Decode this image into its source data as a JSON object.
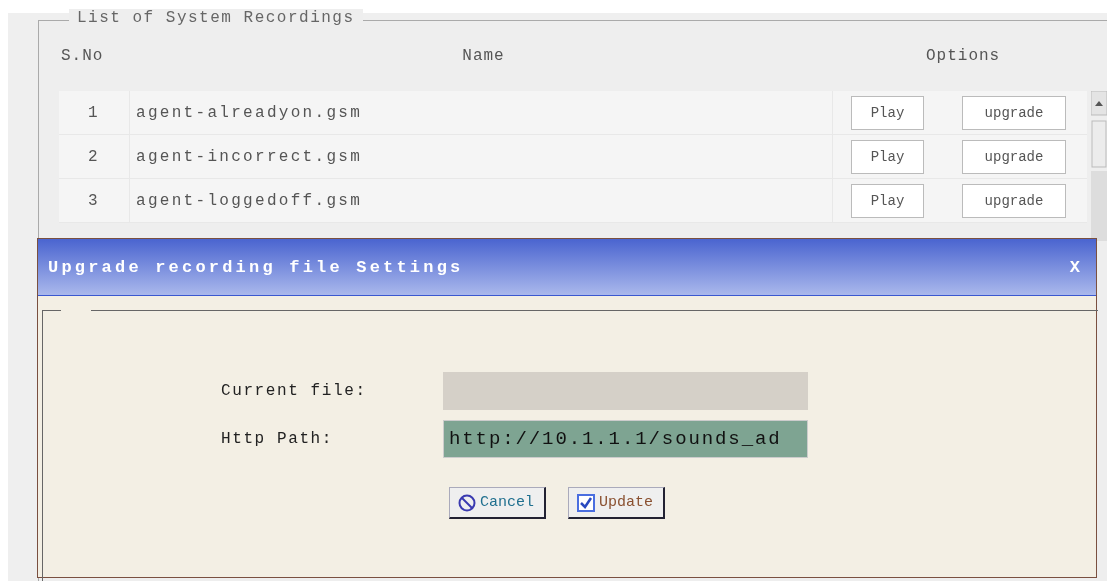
{
  "recordings": {
    "title": "List of System Recordings",
    "columns": [
      "S.No",
      "Name",
      "Options"
    ],
    "rows": [
      {
        "number": "1",
        "name": "agent-alreadyon.gsm",
        "play": "Play",
        "upgrade": "upgrade"
      },
      {
        "number": "2",
        "name": "agent-incorrect.gsm",
        "play": "Play",
        "upgrade": "upgrade"
      },
      {
        "number": "3",
        "name": "agent-loggedoff.gsm",
        "play": "Play",
        "upgrade": "upgrade"
      }
    ]
  },
  "dialog": {
    "title": "Upgrade recording file Settings",
    "close": "X",
    "fields": [
      {
        "label": "Current file:",
        "disabled": true
      },
      {
        "label": "Http Path:",
        "value": "http://10.1.1.1/sounds_ad",
        "disabled": false
      }
    ],
    "buttons": [
      {
        "kind": "cancel",
        "label": "Cancel"
      },
      {
        "kind": "update",
        "label": "Update"
      }
    ]
  }
}
